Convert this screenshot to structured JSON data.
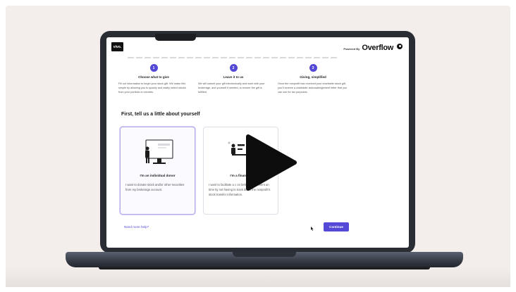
{
  "app": {
    "logo_text": "vivo.",
    "powered_label": "Powered By",
    "powered_brand": "Overflow"
  },
  "steps": [
    {
      "number": "1",
      "title": "Choose what to give",
      "desc": "Fill out information to begin your stock gift. We make this simple by allowing you to quickly and easily select stocks from your portfolio in minutes."
    },
    {
      "number": "2",
      "title": "Leave it to us",
      "desc": "We will submit your gift electronically and work with your brokerage, and yourself if needed, to ensure the gift is fulfilled."
    },
    {
      "number": "3",
      "title": "Giving, simplified",
      "desc": "Once the nonprofit has received your charitable stock gift, you'll receive a charitable acknowledgement letter that you can use for tax purposes."
    }
  ],
  "section": {
    "title": "First, tell us a little about yourself"
  },
  "cards": [
    {
      "title": "I'm an individual donor",
      "desc": "I want to donate stock and/or other securities from my brokerage account.",
      "selected": true
    },
    {
      "title": "I'm a financial",
      "desc": "I want to facilitate a c on behalf of my client an time by not having to track down the nonprofit's stock transfer information.",
      "selected": false
    }
  ],
  "footer": {
    "help_link": "Need more help?",
    "continue_label": "Continue"
  },
  "colors": {
    "accent": "#5349d6",
    "frame_bg": "#f3edeb",
    "laptop": "#2a2d33"
  },
  "icons": [
    "user-icon",
    "play-icon",
    "cursor-icon"
  ]
}
